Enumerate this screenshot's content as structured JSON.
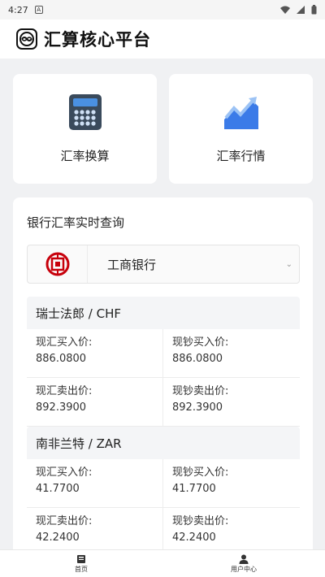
{
  "status_bar": {
    "time": "4:27"
  },
  "header": {
    "title": "汇算核心平台"
  },
  "quick_actions": [
    {
      "label": "汇率换算",
      "icon": "calculator-icon"
    },
    {
      "label": "汇率行情",
      "icon": "trend-chart-icon"
    }
  ],
  "main": {
    "section_title": "银行汇率实时查询",
    "bank_select": {
      "value": "工商银行",
      "logo": "icbc-logo"
    },
    "currencies": [
      {
        "name": "瑞士法郎 / CHF",
        "rows": [
          [
            {
              "label": "现汇买入价:",
              "value": "886.0800"
            },
            {
              "label": "现钞买入价:",
              "value": "886.0800"
            }
          ],
          [
            {
              "label": "现汇卖出价:",
              "value": "892.3900"
            },
            {
              "label": "现钞卖出价:",
              "value": "892.3900"
            }
          ]
        ]
      },
      {
        "name": "南非兰特 / ZAR",
        "rows": [
          [
            {
              "label": "现汇买入价:",
              "value": "41.7700"
            },
            {
              "label": "现钞买入价:",
              "value": "41.7700"
            }
          ],
          [
            {
              "label": "现汇卖出价:",
              "value": "42.2400"
            },
            {
              "label": "现钞卖出价:",
              "value": "42.2400"
            }
          ]
        ]
      }
    ]
  },
  "bottom_nav": [
    {
      "label": "首页",
      "icon": "home-icon"
    },
    {
      "label": "用户中心",
      "icon": "user-icon"
    }
  ],
  "colors": {
    "accent": "#3b7be8",
    "calc_dark": "#3a4a5c",
    "icbc_red": "#c7000b"
  }
}
